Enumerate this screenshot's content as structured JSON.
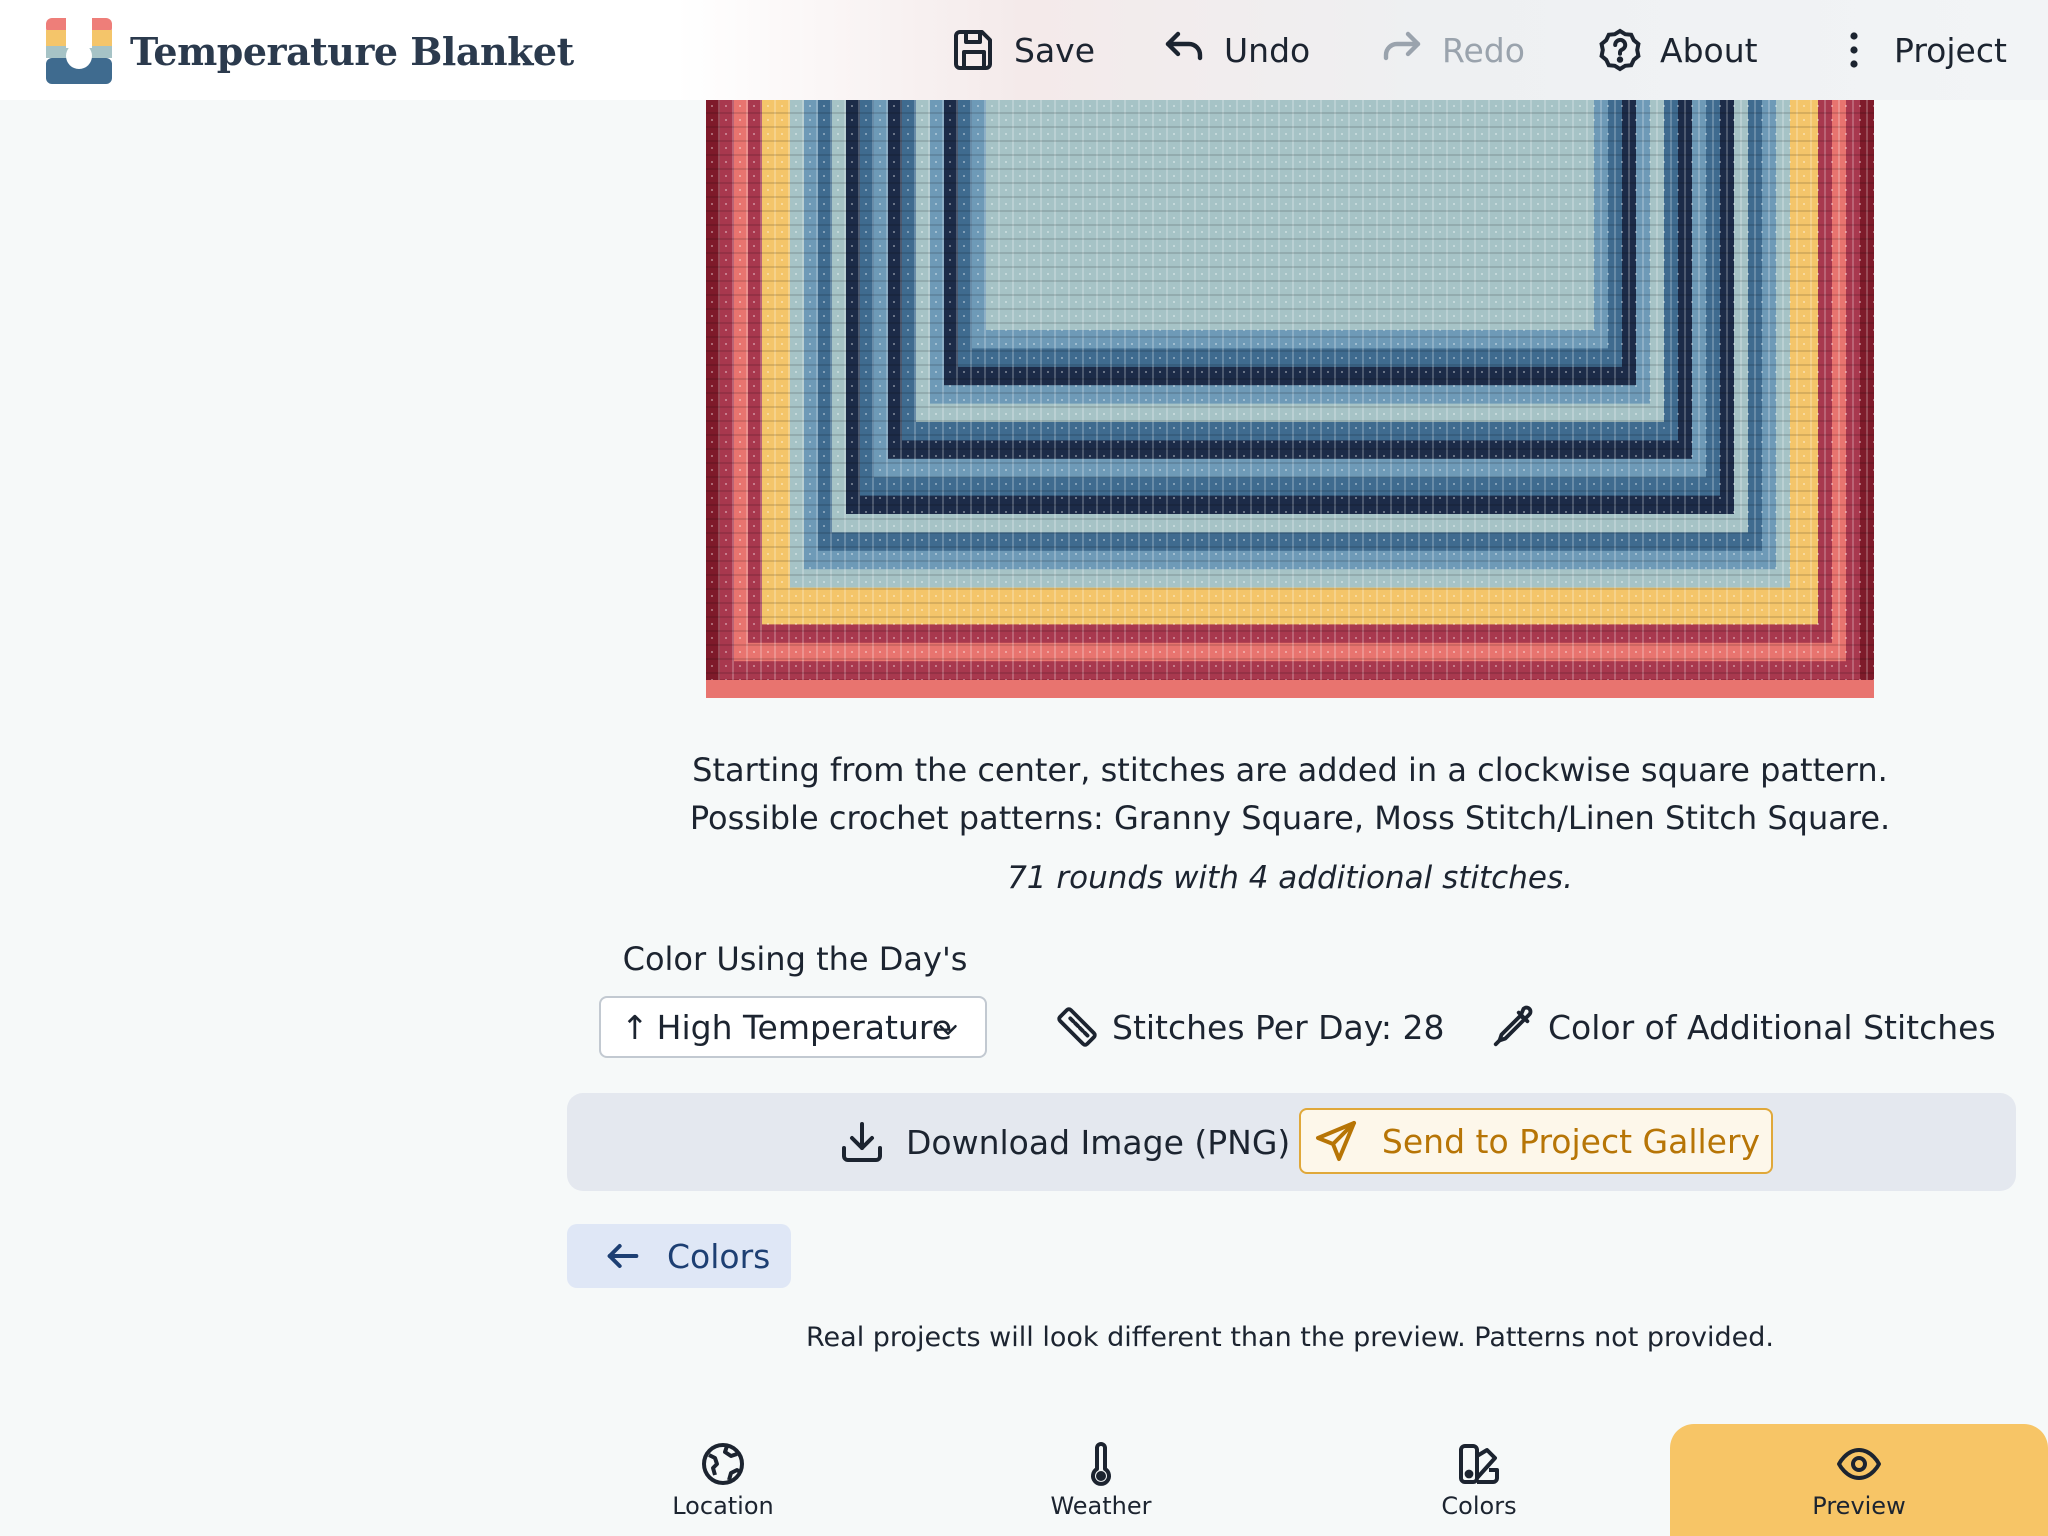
{
  "app": {
    "title": "Temperature Blanket"
  },
  "toolbar": {
    "save_label": "Save",
    "undo_label": "Undo",
    "redo_label": "Redo",
    "about_label": "About",
    "project_label": "Project"
  },
  "preview": {
    "description": "Starting from the center, stitches are added in a clockwise square pattern. Possible crochet patterns: Granny Square, Moss Stitch/Linen Stitch Square.",
    "rounds_note": "71 rounds with 4 additional stitches."
  },
  "options": {
    "color_using_label": "Color Using the Day's",
    "selected_color_source": "High Temperature",
    "stitches_per_day_label": "Stitches Per Day: 28",
    "additional_stitch_color_label": "Color of Additional Stitches"
  },
  "actions": {
    "download_label": "Download Image (PNG)",
    "gallery_label": "Send to Project Gallery",
    "back_label": "Colors"
  },
  "footer_note": "Real projects will look different than the preview. Patterns not provided.",
  "bottom_nav": [
    {
      "label": "Location",
      "icon": "globe-icon"
    },
    {
      "label": "Weather",
      "icon": "thermometer-icon"
    },
    {
      "label": "Colors",
      "icon": "swatchbook-icon"
    },
    {
      "label": "Preview",
      "icon": "eye-icon"
    }
  ],
  "palette": [
    "#7e1a2a",
    "#a8384e",
    "#e8746f",
    "#f4c56a",
    "#a6c3c6",
    "#6e9ab7",
    "#3f6b8f",
    "#1c2b48"
  ],
  "colors": {
    "accent_orange": "#f7c566",
    "gallery_orange": "#b77506",
    "back_blue": "#1d3f73"
  }
}
